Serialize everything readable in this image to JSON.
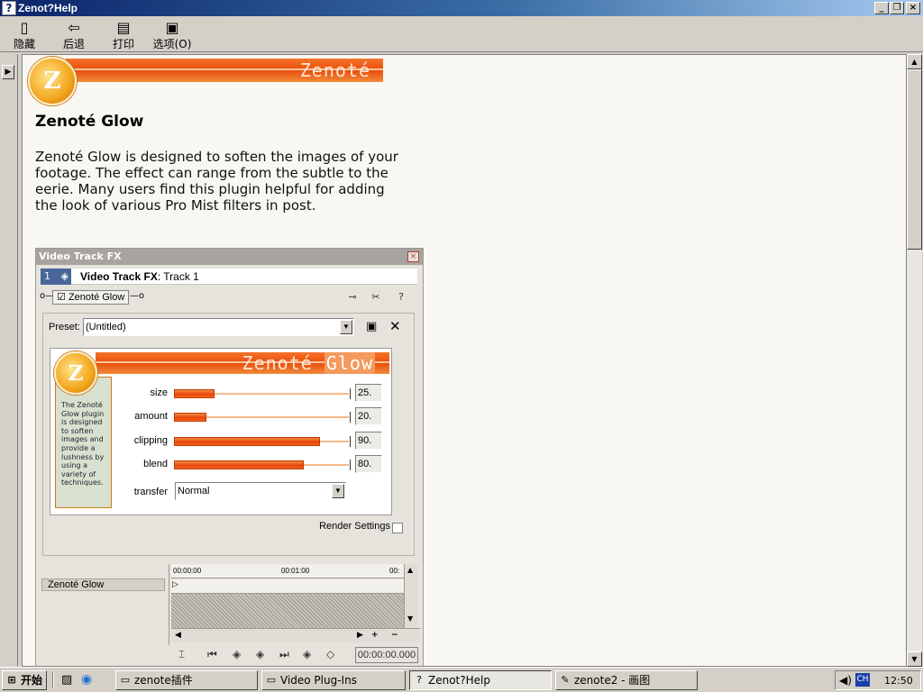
{
  "window": {
    "title": "Zenot?Help"
  },
  "toolbar": {
    "hide": "隐藏",
    "back": "后退",
    "print": "打印",
    "options": "选项(O)"
  },
  "page": {
    "banner_text": "Zenoté",
    "logo_letter": "Z",
    "heading": "Zenoté Glow",
    "description": "Zenoté Glow is designed to soften the images of your footage.  The effect can range from the subtle to the eerie.  Many users find this plugin helpful for adding the look of various Pro Mist filters in post."
  },
  "vfx": {
    "title": "Video Track FX",
    "track_number": "1",
    "track_label_bold": "Video Track FX",
    "track_label_rest": ": Track 1",
    "chain_item": "Zenoté Glow",
    "preset_label": "Preset:",
    "preset_value": "(Untitled)",
    "plugin_banner": "Zenoté",
    "plugin_banner_glow": "Glow",
    "plugin_note": "The Zenoté Glow plugin is designed to soften images and provide a lushness by using a variety of techniques.",
    "params": [
      {
        "label": "size",
        "value": 25,
        "display": "25."
      },
      {
        "label": "amount",
        "value": 20,
        "display": "20."
      },
      {
        "label": "clipping",
        "value": 90,
        "display": "90."
      },
      {
        "label": "blend",
        "value": 80,
        "display": "80."
      }
    ],
    "transfer_label": "transfer",
    "transfer_value": "Normal",
    "render_settings": "Render Settings",
    "timeline": {
      "item": "Zenoté Glow",
      "ruler": [
        "00:00:00",
        "00:01:00",
        "00:"
      ],
      "timecode": "00:00:00.000"
    }
  },
  "taskbar": {
    "start": "开始",
    "tasks": [
      "zenote插件",
      "Video Plug-Ins",
      "Zenot?Help",
      "zenote2 - 画图"
    ],
    "lang": "CH",
    "clock": "12:50"
  },
  "colors": {
    "accent": "#e94e0c",
    "titlebar": "#0a246a"
  }
}
